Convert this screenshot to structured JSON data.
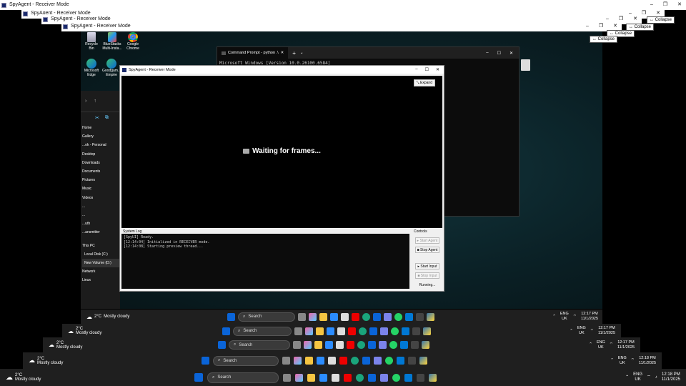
{
  "title_bars": [
    {
      "title": "SpyAgent - Receiver Mode"
    },
    {
      "title": "SpyAgent - Receiver Mode"
    },
    {
      "title": "SpyAgent - Receiver Mode"
    },
    {
      "title": "SpyAgent - Receiver Mode"
    }
  ],
  "collapse_label": "↔ Collapse",
  "desktop_icons": [
    "Recycle Bin",
    "Google Chrome",
    "BlueStacks Multi-Insta...",
    "Microsoft Edge",
    "Goodgam... Empire"
  ],
  "explorer": {
    "items": [
      "Home",
      "Gallery",
      "...ok - Personal",
      "Desktop",
      "Downloads",
      "Documents",
      "Pictures",
      "Music",
      "Videos",
      "...",
      "...",
      "...uth",
      "...ansmitter",
      "This PC",
      "Local Disk (C:)",
      "New Volume (D:)",
      "Network",
      "Linux"
    ]
  },
  "cmd": {
    "tab_title": "Command Prompt - python .\\",
    "line1": "Microsoft Windows [Version 10.0.26100.6584]"
  },
  "receiver": {
    "title": "SpyAgent - Receiver Mode",
    "expand": "⤡ Expand",
    "waiting": "Waiting for frames...",
    "system_log_label": "System Log",
    "log": [
      "[SpyUI] Ready.",
      "[12:14:04] Initialized in RECEIVER mode.",
      "[12:14:08] Starting preview thread..."
    ],
    "controls_label": "Controls",
    "start_agent": "▸ Start Agent",
    "stop_agent": "■ Stop Agent",
    "start_input": "▸ Start Input",
    "stop_input": "■ Stop Input",
    "status": "Running..."
  },
  "taskbars": [
    {
      "temp": "2°C",
      "cond": "Mostly cloudy",
      "search": "Search",
      "lang": "ENG",
      "region": "UK",
      "time": "12:17 PM",
      "date": "11/1/2025"
    },
    {
      "temp": "2°C",
      "cond": "Mostly cloudy",
      "search": "Search",
      "lang": "ENG",
      "region": "UK",
      "time": "12:17 PM",
      "date": "11/1/2025"
    },
    {
      "temp": "2°C",
      "cond": "Mostly cloudy",
      "search": "Search",
      "lang": "ENG",
      "region": "UK",
      "time": "12:17 PM",
      "date": "11/1/2025"
    },
    {
      "temp": "2°C",
      "cond": "Mostly cloudy",
      "search": "Search",
      "lang": "ENG",
      "region": "UK",
      "time": "12:18 PM",
      "date": "11/1/2025"
    },
    {
      "temp": "2°C",
      "cond": "Mostly cloudy",
      "search": "Search",
      "lang": "ENG",
      "region": "UK",
      "time": "12:18 PM",
      "date": "11/1/2025"
    }
  ],
  "colors": {
    "taskbar": "#1f1f1f",
    "accent": "#0a64d8",
    "log_text": "#cfcfcf",
    "desktop_bg": "#0f2a30"
  }
}
